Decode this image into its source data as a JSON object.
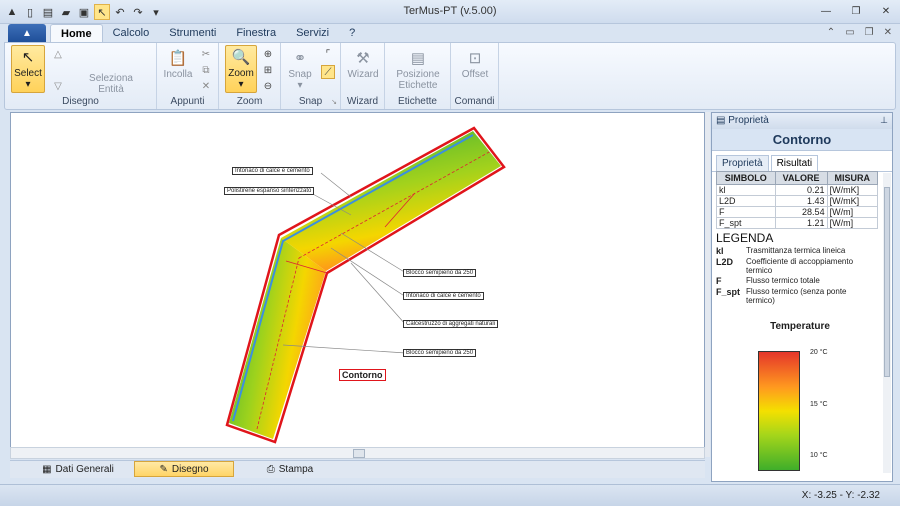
{
  "window": {
    "title": "TerMus-PT (v.5.00)"
  },
  "ribbon": {
    "tabs": [
      "Home",
      "Calcolo",
      "Strumenti",
      "Finestra",
      "Servizi",
      "?"
    ],
    "groups": {
      "disegno": {
        "label": "Disegno",
        "select": "Select",
        "seleziona": "Seleziona Entità"
      },
      "appunti": {
        "label": "Appunti",
        "incolla": "Incolla"
      },
      "zoom": {
        "label": "Zoom",
        "zoom": "Zoom"
      },
      "snap": {
        "label": "Snap",
        "snap": "Snap"
      },
      "wizard": {
        "label": "Wizard",
        "wizard": "Wizard"
      },
      "etichette": {
        "label": "Etichette",
        "posizione": "Posizione Etichette"
      },
      "comandi": {
        "label": "Comandi",
        "offset": "Offset"
      }
    }
  },
  "drawing": {
    "labels": [
      "Intonaco di calce e cemento",
      "Polistirene espanso sinterizzato",
      "Blocco semipieno da 250",
      "Intonaco di calce e cemento",
      "Calcestruzzo di aggregati naturali",
      "Blocco semipieno da 250"
    ],
    "contorno": "Contorno"
  },
  "bottom_tabs": [
    "Dati Generali",
    "Disegno",
    "Stampa"
  ],
  "status": {
    "coords": "X: -3.25 - Y: -2.32"
  },
  "properties": {
    "header": "Proprietà",
    "title": "Contorno",
    "tabs": [
      "Proprietà",
      "Risultati"
    ],
    "table": {
      "headers": [
        "SIMBOLO",
        "VALORE",
        "MISURA"
      ],
      "rows": [
        [
          "kl",
          "0.21",
          "[W/mK]"
        ],
        [
          "L2D",
          "1.43",
          "[W/mK]"
        ],
        [
          "F",
          "28.54",
          "[W/m]"
        ],
        [
          "F_spt",
          "1.21",
          "[W/m]"
        ]
      ]
    },
    "legenda": "LEGENDA",
    "legend_items": [
      {
        "sym": "kl",
        "desc": "Trasmittanza termica lineica"
      },
      {
        "sym": "L2D",
        "desc": "Coefficiente di accoppiamento termico"
      },
      {
        "sym": "F",
        "desc": "Flusso termico totale"
      },
      {
        "sym": "F_spt",
        "desc": "Flusso termico (senza ponte termico)"
      }
    ],
    "temp_title": "Temperature",
    "temp_labels": [
      "20 °C",
      "15 °C",
      "10 °C"
    ]
  },
  "colors": {
    "accent": "#ffd25a",
    "contour": "#e0151b",
    "ribbon_bg": "#e3ebf6"
  }
}
